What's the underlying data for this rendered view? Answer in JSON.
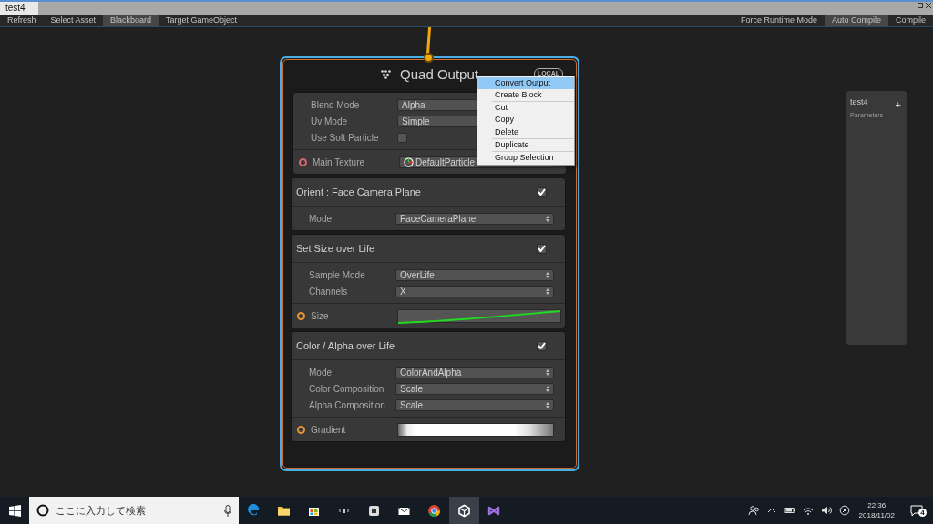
{
  "window": {
    "tab": "test4"
  },
  "toolbar": {
    "left": [
      {
        "label": "Refresh",
        "selected": false
      },
      {
        "label": "Select Asset",
        "selected": false
      },
      {
        "label": "Blackboard",
        "selected": true
      },
      {
        "label": "Target GameObject",
        "selected": false
      }
    ],
    "right": [
      {
        "label": "Force Runtime Mode",
        "selected": false
      },
      {
        "label": "Auto Compile",
        "selected": true
      },
      {
        "label": "Compile",
        "selected": false
      }
    ]
  },
  "node": {
    "title": "Quad Output",
    "badge": "LOCAL",
    "settings": [
      {
        "kind": "dropdown",
        "label": "Blend Mode",
        "value": "Alpha"
      },
      {
        "kind": "dropdown",
        "label": "Uv Mode",
        "value": "Simple"
      },
      {
        "kind": "checkbox",
        "label": "Use Soft Particle",
        "checked": false
      }
    ],
    "slots": [
      {
        "kind": "texture",
        "label": "Main Texture",
        "value": "DefaultParticle",
        "color": "#d9676c"
      }
    ],
    "blocks": [
      {
        "title": "Orient : Face Camera Plane",
        "enabled": true,
        "settings": [
          {
            "kind": "dropdown",
            "label": "Mode",
            "value": "FaceCameraPlane"
          }
        ]
      },
      {
        "title": "Set Size over Life",
        "enabled": true,
        "settings": [
          {
            "kind": "dropdown",
            "label": "Sample Mode",
            "value": "OverLife"
          },
          {
            "kind": "dropdown",
            "label": "Channels",
            "value": "X"
          }
        ],
        "slots": [
          {
            "kind": "curve",
            "label": "Size",
            "color": "#e8953a"
          }
        ]
      },
      {
        "title": "Color / Alpha over Life",
        "enabled": true,
        "settings": [
          {
            "kind": "dropdown",
            "label": "Mode",
            "value": "ColorAndAlpha"
          },
          {
            "kind": "dropdown",
            "label": "Color Composition",
            "value": "Scale"
          },
          {
            "kind": "dropdown",
            "label": "Alpha Composition",
            "value": "Scale"
          }
        ],
        "slots": [
          {
            "kind": "gradient",
            "label": "Gradient",
            "color": "#e8953a"
          }
        ]
      }
    ]
  },
  "context_menu": {
    "groups": [
      [
        {
          "label": "Convert Output",
          "selected": true
        },
        {
          "label": "Create Block",
          "selected": false
        }
      ],
      [
        {
          "label": "Cut",
          "selected": false
        },
        {
          "label": "Copy",
          "selected": false
        }
      ],
      [
        {
          "label": "Delete",
          "selected": false
        }
      ],
      [
        {
          "label": "Duplicate",
          "selected": false
        }
      ],
      [
        {
          "label": "Group Selection",
          "selected": false
        }
      ]
    ]
  },
  "blackboard": {
    "title": "test4",
    "subtitle": "Parameters",
    "add": "+"
  },
  "taskbar": {
    "search_placeholder": "ここに入力して検索",
    "time": "22:36",
    "date": "2018/11/02",
    "notifications": "4"
  }
}
